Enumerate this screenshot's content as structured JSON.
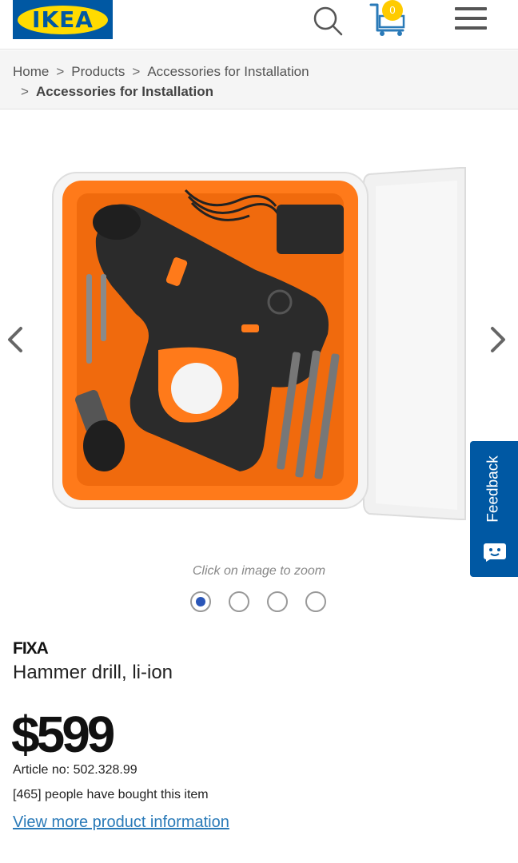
{
  "header": {
    "logo_text": "IKEA",
    "cart_count": "0",
    "brand_color": "#0058a3",
    "logo_accent": "#ffdb00",
    "icons": [
      "search-icon",
      "cart-icon",
      "menu-icon"
    ]
  },
  "breadcrumb": {
    "items": [
      "Home",
      "Products",
      "Accessories for Installation"
    ],
    "current": "Accessories for Installation",
    "separator": ">"
  },
  "gallery": {
    "zoom_hint": "Click on image to zoom",
    "slide_count": 4,
    "active_slide": 1
  },
  "feedback": {
    "label": "Feedback"
  },
  "product": {
    "brand": "FIXA",
    "description": "Hammer drill, li-ion",
    "price": "$599",
    "article": "Article no: 502.328.99",
    "bought": "[465] people have bought this item",
    "more_info_link": "View more product information"
  },
  "colors": {
    "case_orange": "#ff7a1a",
    "link_blue": "#2a7ab8",
    "dot_active": "#2a56b8"
  }
}
